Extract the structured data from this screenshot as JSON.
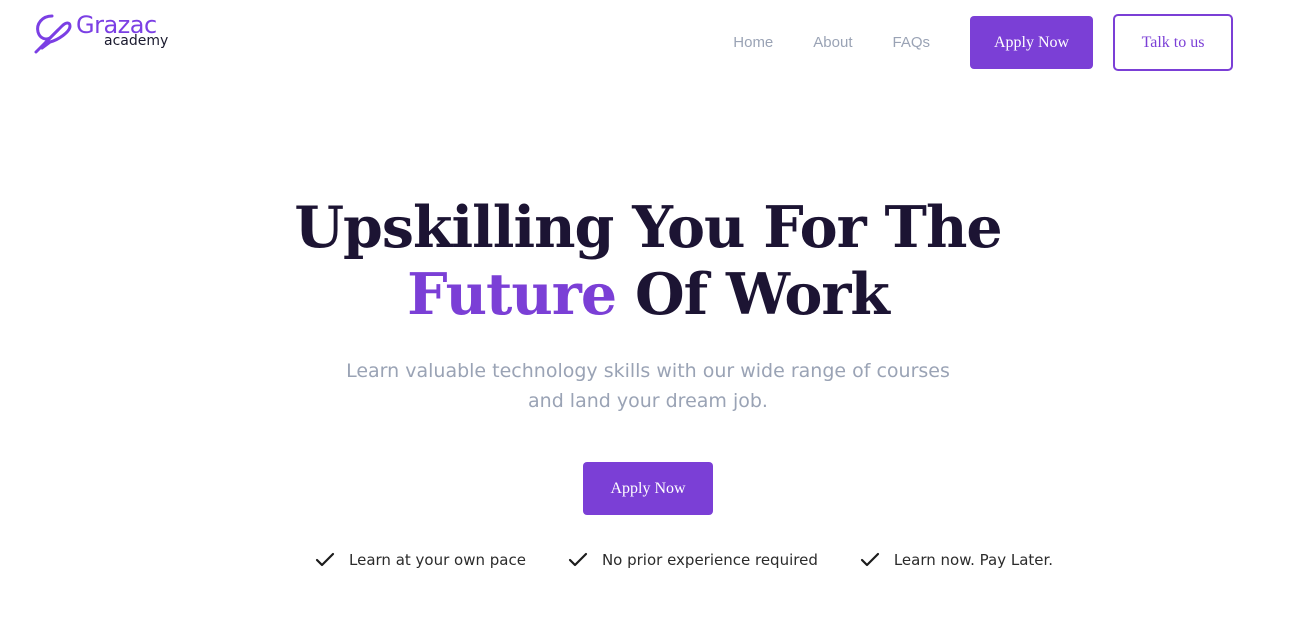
{
  "brand": {
    "name": "Grazac",
    "tagline": "academy",
    "color": "#7b3fe4"
  },
  "nav": {
    "links": [
      "Home",
      "About",
      "FAQs"
    ],
    "apply_label": "Apply Now",
    "talk_label": "Talk to us"
  },
  "hero": {
    "title_line1": "Upskilling You For The",
    "title_accent": "Future",
    "title_rest": "Of Work",
    "subtitle_line1": "Learn valuable technology skills with our wide range of courses",
    "subtitle_line2": "and land your dream job.",
    "cta_label": "Apply Now"
  },
  "features": [
    {
      "icon": "check-icon",
      "label": "Learn at your own pace"
    },
    {
      "icon": "check-icon",
      "label": "No prior experience required"
    },
    {
      "icon": "check-icon",
      "label": "Learn now. Pay Later."
    }
  ],
  "colors": {
    "accent": "#7b3fd6",
    "heading": "#1c1433",
    "muted": "#9aa3b5"
  }
}
